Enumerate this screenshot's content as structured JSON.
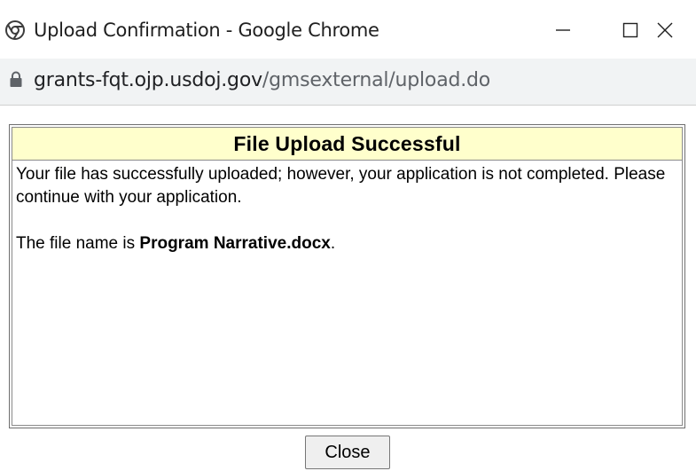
{
  "window": {
    "title": "Upload Confirmation - Google Chrome",
    "controls": {
      "minimize_icon": "minimize-icon",
      "maximize_icon": "maximize-icon",
      "close_icon": "close-icon"
    },
    "app_icon": "chrome-icon"
  },
  "addressbar": {
    "lock_icon": "lock-icon",
    "url_domain": "grants-fqt.ojp.usdoj.gov",
    "url_path": "/gmsexternal/upload.do"
  },
  "dialog": {
    "header": "File Upload Successful",
    "message": "Your file has successfully uploaded; however, your application is not completed. Please continue with your application.",
    "file_line_prefix": "The file name is ",
    "file_name": "Program Narrative.docx",
    "file_line_suffix": "."
  },
  "footer": {
    "close_label": "Close"
  },
  "colors": {
    "header_bg": "#ffffcc",
    "addressbar_bg": "#f1f3f4",
    "url_path": "#5f6368"
  }
}
